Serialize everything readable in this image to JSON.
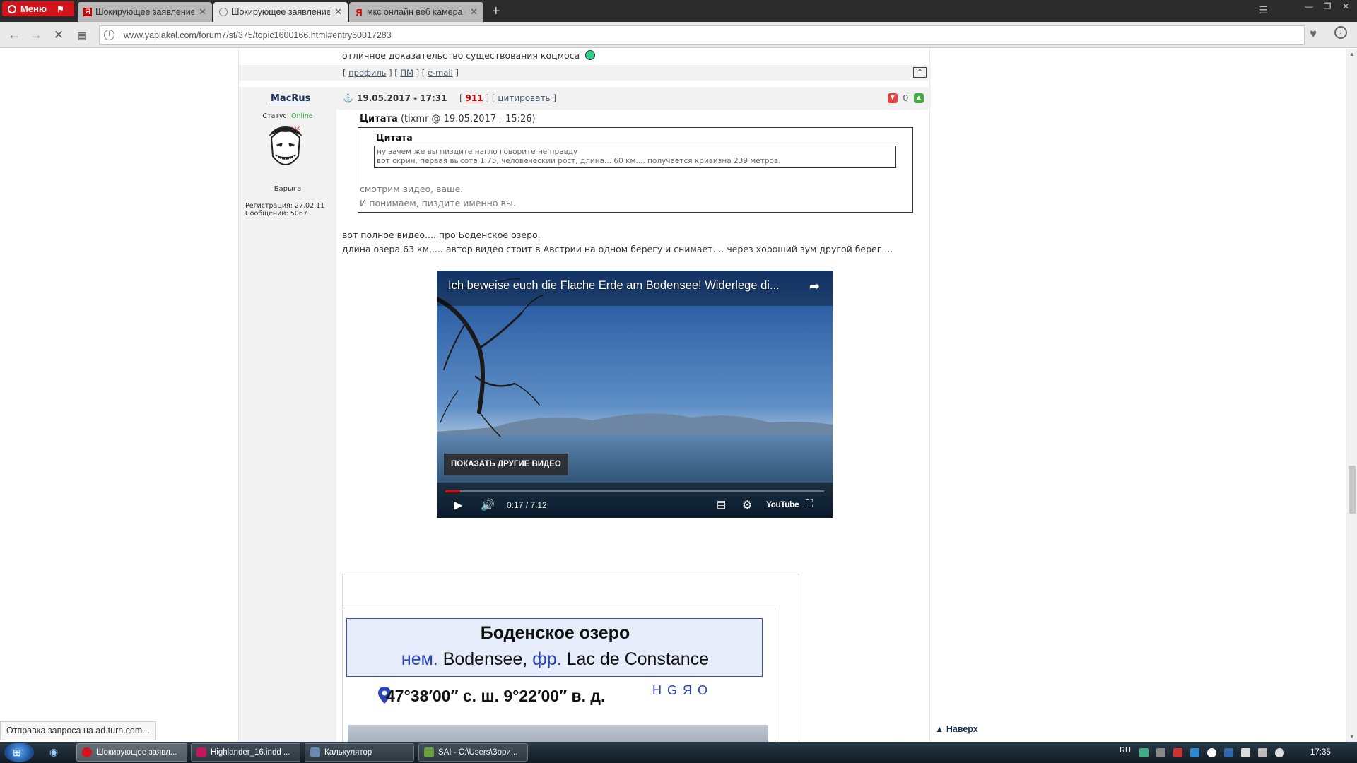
{
  "browser": {
    "menu_label": "Меню",
    "tabs": [
      {
        "label": "Шокирующее заявление"
      },
      {
        "label": "Шокирующее заявление"
      },
      {
        "label": "мкс онлайн веб камера -"
      }
    ],
    "url": "www.yaplakal.com/forum7/st/375/topic1600166.html#entry60017283"
  },
  "prev_post": {
    "text": "отличное доказательство существования коцмоса",
    "links_text": "[ профиль ] [ ПМ ] [ e-mail ]",
    "links": [
      "профиль",
      "ПМ",
      "e-mail"
    ]
  },
  "post": {
    "author": "MacRus",
    "date": "19.05.2017 - 17:31",
    "post_number": "911",
    "quote_label": "цитировать",
    "rating_value": "0",
    "status_label": "Статус:",
    "status_value": "Online",
    "user_title": "Барыга",
    "reg_line": "Регистрация: 27.02.11",
    "posts_line": "Сообщений: 5067",
    "quote": {
      "header_bold": "Цитата",
      "header_rest": "(tixmr @ 19.05.2017 - 15:26)",
      "inner_title": "Цитата",
      "inner_lines": [
        "ну зачем же вы пиздите нагло говорите не правду",
        "вот скрин, первая высота 1.75, человеческий рост, длина... 60 км.... получается кривизна 239 метров."
      ],
      "reply_lines": [
        "смотрим видео, ваше.",
        "И понимаем, пиздите именно вы."
      ]
    },
    "body_lines": [
      "вот полное видео.... про Боденское озеро.",
      "длина озера 63 км,.... автор видео стоит в Австрии на одном берегу и снимает.... через хороший зум другой берег...."
    ],
    "video": {
      "title": "Ich beweise euch die Flache Erde am Bodensee! Widerlege di...",
      "more_videos_label": "ПОКАЗАТЬ ДРУГИЕ ВИДЕО",
      "time": "0:17 / 7:12",
      "progress": 0.04,
      "logo_text": "YouTube"
    },
    "infobox": {
      "title": "Боденское озеро",
      "lang1": "нем.",
      "name1": "Bodensee,",
      "lang2": "фр.",
      "name2": "Lac de Constance",
      "coords": "47°38′00″ с. ш. 9°22′00″ в. д.",
      "coord_links": "HGЯO"
    }
  },
  "page": {
    "nav_up": "Наверх"
  },
  "status_bar": {
    "text": "Отправка запроса на ad.turn.com..."
  },
  "taskbar": {
    "tasks": [
      {
        "label": "Шокирующее заявл...",
        "color": "#d5131b"
      },
      {
        "label": "Highlander_16.indd ...",
        "color": "#c2185b"
      },
      {
        "label": "Калькулятор",
        "color": "#6a8ab0"
      },
      {
        "label": "SAI - C:\\Users\\Зори...",
        "color": "#6aa040"
      }
    ],
    "language": "RU",
    "clock": "17:35"
  },
  "colors": {
    "opera_red": "#d5131b",
    "link_blue": "#1a3155",
    "online_green": "#33aa33",
    "infobox_blue": "#2844b8"
  }
}
